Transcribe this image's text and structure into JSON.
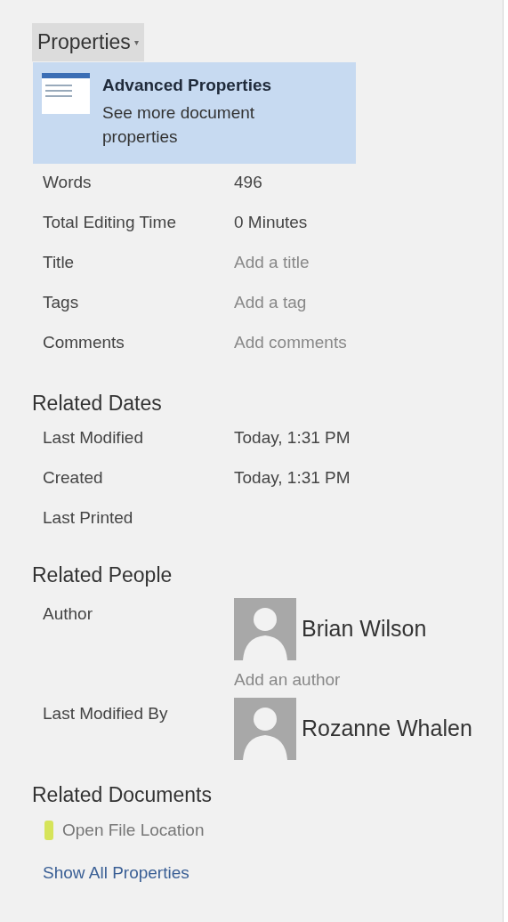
{
  "header": {
    "label": "Properties",
    "caret": "▾",
    "expanded": true
  },
  "menu": {
    "title": "Advanced Properties",
    "description": "See more document properties"
  },
  "properties": [
    {
      "label": "Words",
      "value": "496",
      "kind": "text"
    },
    {
      "label": "Total Editing Time",
      "value": "0 Minutes",
      "kind": "text"
    },
    {
      "label": "Title",
      "placeholder": "Add a title",
      "kind": "input"
    },
    {
      "label": "Tags",
      "placeholder": "Add a tag",
      "kind": "input"
    },
    {
      "label": "Comments",
      "placeholder": "Add comments",
      "kind": "input"
    }
  ],
  "related_dates": {
    "heading": "Related Dates",
    "rows": [
      {
        "label": "Last Modified",
        "value": "Today, 1:31 PM"
      },
      {
        "label": "Created",
        "value": "Today, 1:31 PM"
      },
      {
        "label": "Last Printed"
      }
    ]
  },
  "related_people": {
    "heading": "Related People",
    "rows": [
      {
        "label": "Author",
        "name": "Brian Wilson",
        "add": "Add an author"
      },
      {
        "label": "Last Modified By",
        "name": "Rozanne Whalen"
      }
    ]
  },
  "related_documents": {
    "heading": "Related Documents",
    "link": "Open File Location"
  },
  "footer_link": "Show All Properties"
}
